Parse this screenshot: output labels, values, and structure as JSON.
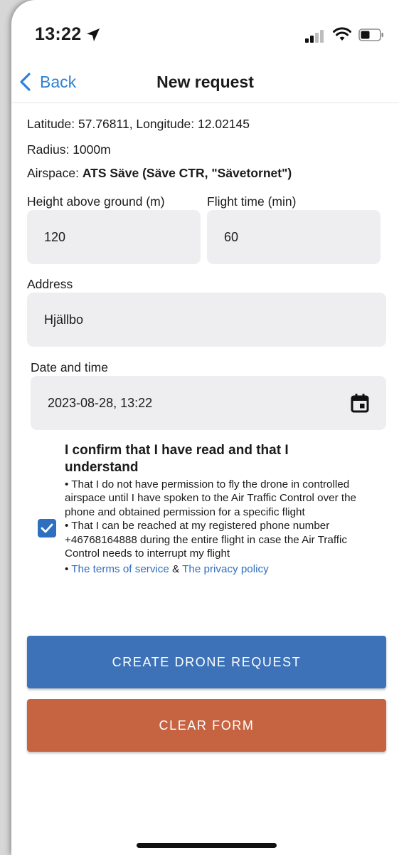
{
  "status_bar": {
    "time": "13:22",
    "icons": [
      "location-arrow-icon",
      "cellular-signal-icon",
      "wifi-icon",
      "battery-icon"
    ]
  },
  "nav": {
    "back_label": "Back",
    "title": "New request"
  },
  "info": {
    "coordinates": "Latitude: 57.76811, Longitude: 12.02145",
    "radius": "Radius: 1000m",
    "airspace_prefix": "Airspace: ",
    "airspace_value": "ATS Säve (Säve CTR, \"Sävetornet\")"
  },
  "form": {
    "height_label": "Height above ground (m)",
    "height_value": "120",
    "flight_time_label": "Flight time (min)",
    "flight_time_value": "60",
    "address_label": "Address",
    "address_value": "Hjällbo",
    "datetime_label": "Date and time",
    "datetime_value": "2023-08-28, 13:22"
  },
  "confirm": {
    "checked": true,
    "title": "I confirm that I have read and that I understand",
    "point1": "• That I do not have permission to fly the drone in controlled airspace until I have spoken to the Air Traffic Control over the phone and obtained permission for a specific flight",
    "point2": "• That I can be reached at my registered phone number +46768164888 during the entire flight in case the Air Traffic Control needs to interrupt my flight",
    "links_prefix": "• ",
    "terms_link": "The terms of service",
    "links_separator": " & ",
    "privacy_link": "The privacy policy"
  },
  "buttons": {
    "create": "CREATE DRONE REQUEST",
    "clear": "CLEAR FORM"
  },
  "colors": {
    "accent_blue": "#2f80d8",
    "create_button": "#3d72b8",
    "clear_button": "#c66442",
    "input_background": "#eeeef1"
  }
}
